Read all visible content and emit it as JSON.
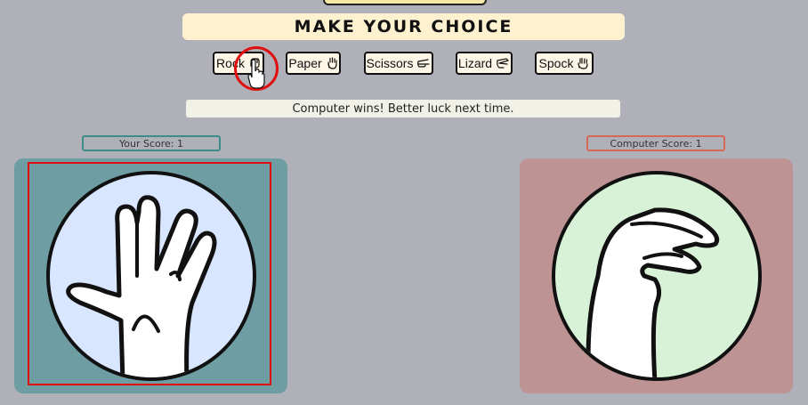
{
  "title": "MAKE YOUR CHOICE",
  "choices": [
    {
      "label": "Rock",
      "icon": "rock-hand-icon"
    },
    {
      "label": "Paper",
      "icon": "paper-hand-icon"
    },
    {
      "label": "Scissors",
      "icon": "scissors-hand-icon"
    },
    {
      "label": "Lizard",
      "icon": "lizard-hand-icon"
    },
    {
      "label": "Spock",
      "icon": "spock-hand-icon"
    }
  ],
  "result_message": "Computer wins! Better luck next time.",
  "player": {
    "score_text": "Your Score: 1",
    "choice_icon": "spock-hand-icon",
    "panel_color": "#6e9ea3",
    "circle_color": "#d9e6ff"
  },
  "computer": {
    "score_text": "Computer Score: 1",
    "choice_icon": "lizard-hand-icon",
    "panel_color": "#be9394",
    "circle_color": "#d8f2d8"
  },
  "highlight_color": "#e01010"
}
